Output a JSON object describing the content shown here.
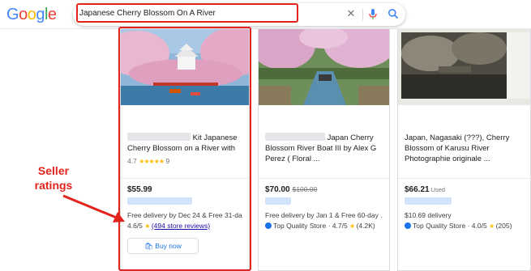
{
  "header": {
    "logo_letters": [
      {
        "ch": "G",
        "color": "#4285f4"
      },
      {
        "ch": "o",
        "color": "#ea4335"
      },
      {
        "ch": "o",
        "color": "#fbbc05"
      },
      {
        "ch": "g",
        "color": "#4285f4"
      },
      {
        "ch": "l",
        "color": "#34a853"
      },
      {
        "ch": "e",
        "color": "#ea4335"
      }
    ],
    "search_query": "Japanese Cherry Blossom On A River",
    "clear_icon": "close-icon",
    "mic_icon": "microphone-icon",
    "search_icon": "search-icon"
  },
  "cards": [
    {
      "title_suffix": "Kit Japanese",
      "title_line2": "Cherry Blossom on a River with",
      "rating": "4.7",
      "stars": "★★★★★",
      "review_count": "9",
      "price": "$55.99",
      "delivery": "Free delivery by Dec 24 & Free 31-da...",
      "store_rating": "4.6/5",
      "store_star": "★",
      "store_reviews": "(494 store reviews)",
      "buy_label": "Buy now",
      "buy_icon": "shopping-bag-icon"
    },
    {
      "title_suffix": "Japan Cherry",
      "title_line2": "Blossom River Boat III by Alex G",
      "title_line3": "Perez ( Floral ...",
      "price": "$70.00",
      "price_old": "$100.00",
      "delivery": "Free delivery by Jan 1 & Free 60-day ...",
      "store_badge": "Top Quality Store",
      "store_rating": "4.7/5",
      "store_star": "★",
      "store_reviews": "(4.2K)"
    },
    {
      "title_line1": "Japan, Nagasaki (???), Cherry",
      "title_line2": "Blossom of Karusu River",
      "title_line3": "Photographie originale ...",
      "price": "$66.21",
      "used_label": "Used",
      "delivery": "$10.69 delivery",
      "store_badge": "Top Quality Store",
      "store_rating": "4.0/5",
      "store_star": "★",
      "store_reviews": "(205)"
    }
  ],
  "annotation": {
    "label": "Seller ratings",
    "color": "#e3241e"
  }
}
